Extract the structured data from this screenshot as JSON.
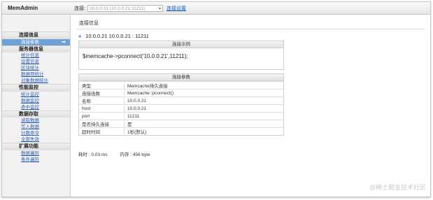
{
  "app": {
    "title": "MemAdmin"
  },
  "toolbar": {
    "connection_label": "连接:",
    "connection_value": "10.0.0.21 (10.0.0.21:11211)",
    "settings_link": "连接设置"
  },
  "sidebar": {
    "groups": [
      {
        "title": "连接信息",
        "items": [
          {
            "label": "连接参数",
            "active": true
          }
        ]
      },
      {
        "title": "服务器信息",
        "items": [
          {
            "label": "统计信息"
          },
          {
            "label": "设置信息"
          },
          {
            "label": "区块统计"
          },
          {
            "label": "数据项统计"
          },
          {
            "label": "对象数据统计"
          }
        ]
      },
      {
        "title": "性能监控",
        "items": [
          {
            "label": "统计监控"
          },
          {
            "label": "数据监控"
          },
          {
            "label": "命中监控"
          }
        ]
      },
      {
        "title": "数据存取",
        "items": [
          {
            "label": "读取数据"
          },
          {
            "label": "写入数据"
          },
          {
            "label": "计数命令"
          },
          {
            "label": "全部失效"
          }
        ]
      },
      {
        "title": "扩展功能",
        "items": [
          {
            "label": "数据遍历"
          },
          {
            "label": "条件遍历"
          }
        ]
      }
    ]
  },
  "main": {
    "page_title": "连接信息",
    "server": "10.0.0.21 10.0.0.21 : 11211",
    "example_panel": {
      "title": "连接示例",
      "code": "$memcache->pconnect('10.0.0.21',11211);"
    },
    "params_panel": {
      "title": "连接参数",
      "rows": [
        {
          "key": "类型",
          "value": "Memcache持久连接"
        },
        {
          "key": "连接函数",
          "value": "Memcache::pconnect()"
        },
        {
          "key": "名称",
          "value": "10.0.0.21"
        },
        {
          "key": "host",
          "value": "10.0.0.21"
        },
        {
          "key": "port",
          "value": "11211"
        },
        {
          "key": "是否持久连接",
          "value": "是"
        },
        {
          "key": "超时时间",
          "value": "1秒(默认)"
        }
      ]
    },
    "stats": {
      "time": "耗时 : 0.03 ms",
      "memory": "内存 : 456 byte"
    }
  },
  "watermark": "@稀土掘金技术社区"
}
